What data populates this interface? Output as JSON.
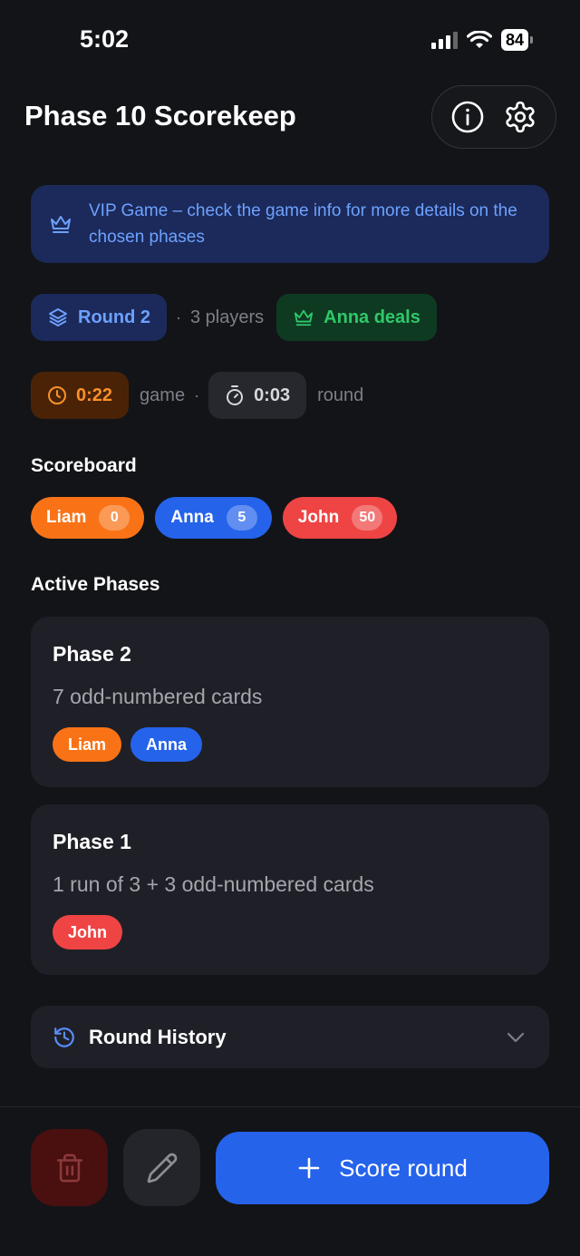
{
  "status_bar": {
    "time": "5:02",
    "battery": "84"
  },
  "header": {
    "title": "Phase 10 Scorekeep"
  },
  "vip_banner": {
    "text": "VIP Game – check the game info for more details on the chosen phases"
  },
  "round_info": {
    "round_label": "Round 2",
    "separator": "·",
    "players_label": "3 players",
    "dealer_label": "Anna deals"
  },
  "timers": {
    "game_time": "0:22",
    "game_label": "game",
    "separator": "·",
    "round_time": "0:03",
    "round_label": "round"
  },
  "scoreboard": {
    "title": "Scoreboard",
    "players": [
      {
        "name": "Liam",
        "score": "0",
        "color": "#f97316"
      },
      {
        "name": "Anna",
        "score": "5",
        "color": "#2563eb"
      },
      {
        "name": "John",
        "score": "50",
        "color": "#ef4444"
      }
    ]
  },
  "active_phases": {
    "title": "Active Phases",
    "phases": [
      {
        "title": "Phase 2",
        "description": "7 odd-numbered cards",
        "players": [
          {
            "name": "Liam",
            "color": "#f97316"
          },
          {
            "name": "Anna",
            "color": "#2563eb"
          }
        ]
      },
      {
        "title": "Phase 1",
        "description": "1 run of 3 + 3 odd-numbered cards",
        "players": [
          {
            "name": "John",
            "color": "#ef4444"
          }
        ]
      }
    ]
  },
  "round_history": {
    "label": "Round History"
  },
  "actions": {
    "score_round_label": "Score round"
  },
  "icons": {
    "info": "info-icon",
    "settings": "gear-icon",
    "crown": "crown-icon",
    "layers": "layers-icon",
    "clock": "clock-icon",
    "stopwatch": "stopwatch-icon",
    "history": "history-icon",
    "chevron": "chevron-down-icon",
    "trash": "trash-icon",
    "pencil": "pencil-icon",
    "plus": "plus-icon"
  },
  "colors": {
    "accent": "#2563eb",
    "green": "#2fc86a",
    "orange": "#f9912b",
    "danger": "#ef4444"
  }
}
